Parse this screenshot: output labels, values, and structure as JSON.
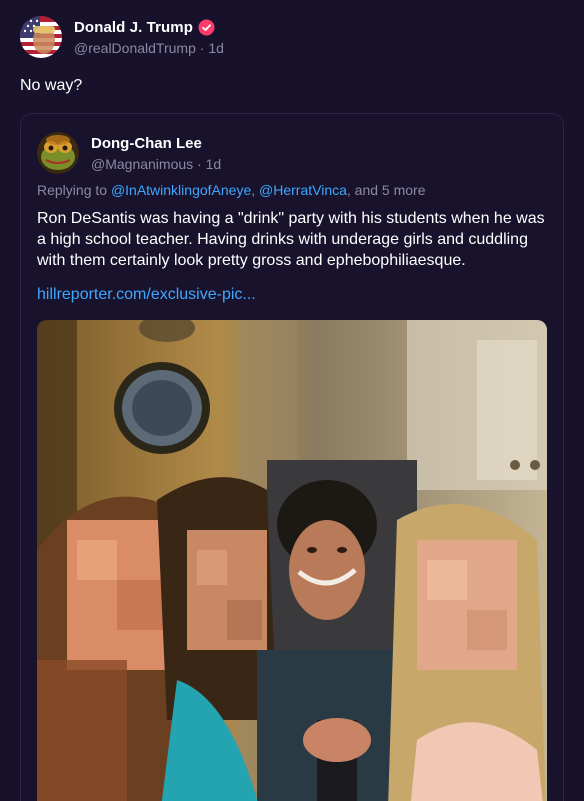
{
  "post": {
    "author": {
      "display_name": "Donald J. Trump",
      "handle": "@realDonaldTrump",
      "separator": "·",
      "time": "1d",
      "verified_icon": "verified-badge-icon",
      "badge_color": "#ff3b6b"
    },
    "text": "No way?"
  },
  "quote": {
    "author": {
      "display_name": "Dong-Chan Lee",
      "handle": "@Magnanimous",
      "separator": "·",
      "time": "1d"
    },
    "replying": {
      "prefix": "Replying to",
      "mentions": [
        "@InAtwinklingofAneye",
        "@HerratVinca"
      ],
      "comma": ",",
      "suffix": ", and 5 more"
    },
    "body": "Ron DeSantis was having a \"drink\" party with his students when he was a high school teacher. Having drinks with underage girls and cuddling with them certainly look pretty gross and ephebophiliaesque.",
    "link": "hillreporter.com/exclusive-pic...",
    "image_icon": "group-photo-image"
  },
  "colors": {
    "background": "#17112b",
    "text_secondary": "#8d88a3",
    "link": "#3fa7ff",
    "card_border": "#2c2445"
  }
}
